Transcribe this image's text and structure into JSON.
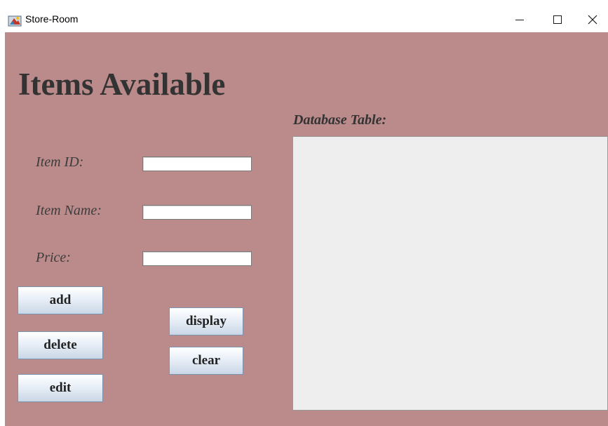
{
  "window": {
    "title": "Store-Room",
    "icon": "java-app-icon",
    "controls": {
      "minimize": "—",
      "maximize": "☐",
      "close": "✕"
    }
  },
  "form": {
    "heading": "Items Available",
    "table_label": "Database Table:",
    "fields": {
      "item_id": {
        "label": "Item ID:",
        "value": ""
      },
      "item_name": {
        "label": "Item Name:",
        "value": ""
      },
      "price": {
        "label": "Price:",
        "value": ""
      }
    },
    "buttons": {
      "add": "add",
      "delete": "delete",
      "edit": "edit",
      "display": "display",
      "clear": "clear"
    }
  },
  "colors": {
    "panel_background": "#bb8a8a",
    "table_background": "#eeeeee",
    "heading_text": "#333333"
  }
}
